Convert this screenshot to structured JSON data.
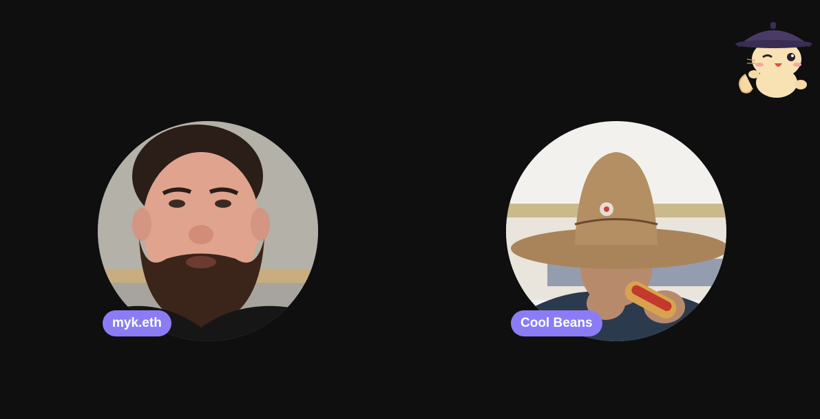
{
  "call": {
    "participants": [
      {
        "name": "myk.eth",
        "video": "man-with-beard-webcam"
      },
      {
        "name": "Cool Beans",
        "video": "man-in-straw-hat-eating-hot-dog"
      }
    ]
  },
  "mascot": {
    "icon": "cat-with-hat-mascot-icon"
  },
  "colors": {
    "background": "#0f0f10",
    "name_pill": "#8b7cf6",
    "name_text": "#ffffff"
  }
}
